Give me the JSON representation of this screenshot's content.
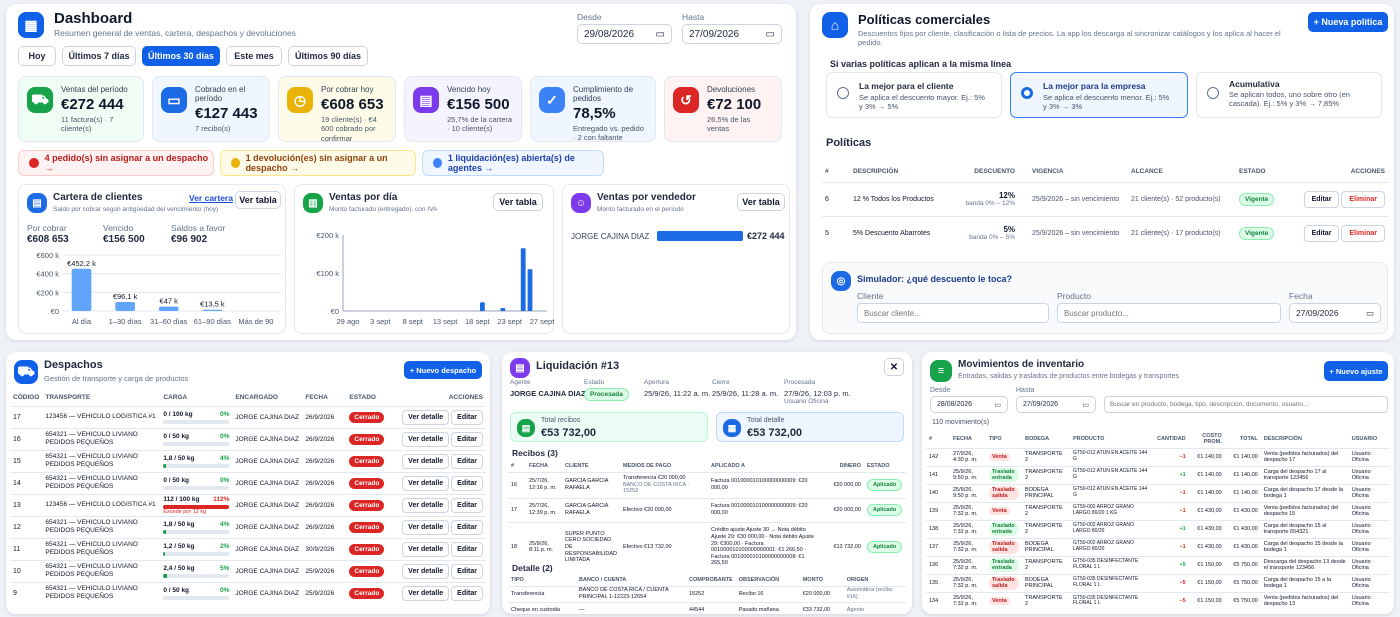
{
  "dashboard": {
    "title": "Dashboard",
    "subtitle": "Resumen general de ventas, cartera, despachos y devoluciones",
    "desde_label": "Desde",
    "desde_value": "29/08/2026",
    "hasta_label": "Hasta",
    "hasta_value": "27/09/2026",
    "ranges": [
      "Hoy",
      "Últimos 7 días",
      "Últimos 30 días",
      "Este mes",
      "Últimos 90 días"
    ],
    "kpis": [
      {
        "label": "Ventas del período",
        "value": "€272 444",
        "sub": "11 factura(s) · 7 cliente(s)"
      },
      {
        "label": "Cobrado en el período",
        "value": "€127 443",
        "sub": "7 recibo(s)"
      },
      {
        "label": "Por cobrar hoy",
        "value": "€608 653",
        "sub": "19 cliente(s) · €4 600 cobrado por confirmar"
      },
      {
        "label": "Vencido hoy",
        "value": "€156 500",
        "sub": "25,7% de la cartera · 10 cliente(s)"
      },
      {
        "label": "Cumplimiento de pedidos",
        "value": "78,5%",
        "sub": "Entregado vs. pedido · 2 con faltante"
      },
      {
        "label": "Devoluciones",
        "value": "€72 100",
        "sub": "26,5% de las ventas"
      }
    ],
    "alerts": [
      "4 pedido(s) sin asignar a un despacho →",
      "1 devolución(es) sin asignar a un despacho →",
      "1 liquidación(es) abierta(s) de agentes →"
    ],
    "cartera": {
      "title": "Cartera de clientes",
      "link": "Ver cartera",
      "button": "Ver tabla",
      "sub": "Saldo por cobrar según antigüedad del vencimiento (hoy)",
      "stats": [
        {
          "l": "Por cobrar",
          "v": "€608 653"
        },
        {
          "l": "Vencido",
          "v": "€156 500"
        },
        {
          "l": "Saldos a favor",
          "v": "€96 902"
        }
      ],
      "yticks": [
        "€600 k",
        "€400 k",
        "€200 k",
        "€0"
      ]
    },
    "ventas_dia": {
      "title": "Ventas por día",
      "sub": "Monto facturado (entregado), con IVA",
      "button": "Ver tabla",
      "yticks": [
        "€200 k",
        "€100 k",
        "€0"
      ]
    },
    "vendedor": {
      "title": "Ventas por vendedor",
      "sub": "Monto facturado en el período",
      "button": "Ver tabla",
      "name": "JORGE CAJINA DIAZ",
      "value": "€272 444"
    }
  },
  "chart_data": [
    {
      "type": "bar",
      "categories": [
        "Al día",
        "1–30 días",
        "31–60 días",
        "61–90 días",
        "Más de 90"
      ],
      "values": [
        452.2,
        96.1,
        47,
        13.5,
        0
      ],
      "labels": [
        "€452,2 k",
        "€96,1 k",
        "€47 k",
        "€13,5 k",
        ""
      ],
      "ylim": [
        0,
        600
      ]
    },
    {
      "type": "bar",
      "categories": [
        "29 ago",
        "3 sept",
        "8 sept",
        "13 sept",
        "18 sept",
        "23 sept",
        "27 sept"
      ],
      "values": [
        0,
        0,
        0,
        0,
        0,
        0,
        0,
        0,
        0,
        0,
        0,
        0,
        0,
        0,
        0,
        0,
        0,
        0,
        0,
        0,
        23,
        0,
        0,
        8,
        0,
        0,
        165,
        110,
        0,
        0
      ],
      "ylim": [
        0,
        200
      ]
    },
    {
      "type": "bar",
      "categories": [
        "JORGE CAJINA DIAZ"
      ],
      "values": [
        272444
      ]
    }
  ],
  "politicas": {
    "title": "Políticas comerciales",
    "sub": "Descuentos fijos por cliente, clasificación o lista de precios. La app los descarga al sincronizar catálogos y los aplica al hacer el pedido.",
    "new_button": "+ Nueva política",
    "question": "Si varias políticas aplican a la misma línea",
    "options": [
      {
        "t": "La mejor para el cliente",
        "d": "Se aplica el descuento mayor. Ej.: 5% y 3% → 5%"
      },
      {
        "t": "La mejor para la empresa",
        "d": "Se aplica el descuento menor. Ej.: 5% y 3% → 3%"
      },
      {
        "t": "Acumulativa",
        "d": "Se aplican todos, uno sobre otro (en cascada). Ej.: 5% y 3% → 7,85%"
      }
    ],
    "list_title": "Políticas",
    "headers": [
      "#",
      "DESCRIPCIÓN",
      "DESCUENTO",
      "VIGENCIA",
      "ALCANCE",
      "ESTADO",
      "ACCIONES"
    ],
    "rows": [
      {
        "n": "6",
        "desc": "12 % Todos los Productos",
        "pct": "12%",
        "band": "banda 0% – 12%",
        "vig": "25/9/2026 – sin vencimiento",
        "alc": "21 cliente(s) · 52 producto(s)",
        "estado": "Vigente"
      },
      {
        "n": "5",
        "desc": "5% Descuento Abarrotes",
        "pct": "5%",
        "band": "banda 0% – 5%",
        "vig": "25/9/2026 – sin vencimiento",
        "alc": "21 cliente(s) · 17 producto(s)",
        "estado": "Vigente"
      }
    ],
    "edit": "Editar",
    "delete": "Eliminar",
    "sim": {
      "title": "Simulador: ¿qué descuento le toca?",
      "cliente_label": "Cliente",
      "cliente_ph": "Buscar cliente...",
      "producto_label": "Producto",
      "producto_ph": "Buscar producto...",
      "fecha_label": "Fecha",
      "fecha_value": "27/09/2026"
    }
  },
  "despachos": {
    "title": "Despachos",
    "sub": "Gestión de transporte y carga de productos",
    "new_button": "+ Nuevo despacho",
    "headers": [
      "CÓDIGO",
      "TRANSPORTE",
      "CARGA",
      "ENCARGADO",
      "FECHA",
      "ESTADO",
      "ACCIONES"
    ],
    "rows": [
      {
        "c": "17",
        "t": "123456 — VEHICULO LOGISTICA #1",
        "carga": "0 / 100 kg",
        "pct": "0%",
        "pv": 0,
        "enc": "JORGE CAJINA DIAZ",
        "f": "26/9/2026",
        "e": "Cerrado"
      },
      {
        "c": "16",
        "t": "654321 — VEHICULO LIVIANO PEDIDOS PEQUEÑOS",
        "carga": "0 / 50 kg",
        "pct": "0%",
        "pv": 0,
        "enc": "JORGE CAJINA DIAZ",
        "f": "26/9/2026",
        "e": "Cerrado"
      },
      {
        "c": "15",
        "t": "654321 — VEHICULO LIVIANO PEDIDOS PEQUEÑOS",
        "carga": "1,8 / 50 kg",
        "pct": "4%",
        "pv": 4,
        "enc": "JORGE CAJINA DIAZ",
        "f": "26/9/2026",
        "e": "Cerrado"
      },
      {
        "c": "14",
        "t": "654321 — VEHICULO LIVIANO PEDIDOS PEQUEÑOS",
        "carga": "0 / 50 kg",
        "pct": "0%",
        "pv": 0,
        "enc": "JORGE CAJINA DIAZ",
        "f": "26/9/2026",
        "e": "Cerrado"
      },
      {
        "c": "13",
        "t": "123456 — VEHICULO LOGISTICA #1",
        "carga": "112 / 100 kg",
        "pct": "112%",
        "pv": 112,
        "over": "Excede por 12 kg",
        "enc": "JORGE CAJINA DIAZ",
        "f": "26/9/2026",
        "e": "Cerrado"
      },
      {
        "c": "12",
        "t": "654321 — VEHICULO LIVIANO PEDIDOS PEQUEÑOS",
        "carga": "1,8 / 50 kg",
        "pct": "4%",
        "pv": 4,
        "enc": "JORGE CAJINA DIAZ",
        "f": "26/9/2026",
        "e": "Cerrado"
      },
      {
        "c": "11",
        "t": "654321 — VEHICULO LIVIANO PEDIDOS PEQUEÑOS",
        "carga": "1,2 / 50 kg",
        "pct": "2%",
        "pv": 2,
        "enc": "JORGE CAJINA DIAZ",
        "f": "30/9/2026",
        "e": "Cerrado"
      },
      {
        "c": "10",
        "t": "654321 — VEHICULO LIVIANO PEDIDOS PEQUEÑOS",
        "carga": "2,4 / 50 kg",
        "pct": "5%",
        "pv": 5,
        "enc": "JORGE CAJINA DIAZ",
        "f": "25/9/2026",
        "e": "Cerrado"
      },
      {
        "c": "9",
        "t": "654321 — VEHICULO LIVIANO PEDIDOS PEQUEÑOS",
        "carga": "0 / 50 kg",
        "pct": "0%",
        "pv": 0,
        "enc": "JORGE CAJINA DIAZ",
        "f": "25/9/2026",
        "e": "Cerrado"
      }
    ],
    "detail": "Ver detalle",
    "edit": "Editar"
  },
  "liquidacion": {
    "title": "Liquidación #13",
    "meta": [
      {
        "l": "Agente",
        "v": "JORGE CAJINA DIAZ"
      },
      {
        "l": "Estado",
        "v": "Procesada"
      },
      {
        "l": "Apertura",
        "v": "25/9/26, 11:22 a. m."
      },
      {
        "l": "Cierre",
        "v": "25/9/26, 11:28 a. m."
      },
      {
        "l": "Procesada",
        "v": "27/9/26, 12:03 p. m.",
        "s": "Usuario Oficina"
      }
    ],
    "tot_recibos_l": "Total recibos",
    "tot_recibos": "€53 732,00",
    "tot_detalle_l": "Total detalle",
    "tot_detalle": "€53 732,00",
    "recibos_title": "Recibos (3)",
    "rh": [
      "#",
      "FECHA",
      "CLIENTE",
      "MEDIOS DE PAGO",
      "APLICADO A",
      "DINERO",
      "ESTADO"
    ],
    "recibos": [
      {
        "n": "16",
        "f": "25/7/26, 12:16 p. m.",
        "c": "GARCIA GARCIA RAFAELA",
        "m": "Transferencia €20 000,00",
        "m2": "BANCO DE COSTA RICA · 15252",
        "a": "Factura 001000010100000000009: €20 000,00",
        "d": "€20 000,00",
        "e": "Aplicado"
      },
      {
        "n": "17",
        "f": "25/7/26, 12:39 p. m.",
        "c": "GARCIA GARCIA RAFAELA",
        "m": "Efectivo €20 000,00",
        "m2": "",
        "a": "Factura 001000010100000000009: €20 000,00",
        "d": "€20 000,00",
        "e": "Aplicado"
      },
      {
        "n": "18",
        "f": "25/9/26, 8:11 p. m.",
        "c": "SUPER PUNTO CERO SOCIEDAD DE RESPONSABILIDAD LIMITADA",
        "m": "Efectivo €13 732,00",
        "m2": "",
        "a": "Crédito ajuste Ajuste 30 → Nota débito Ajuste 29: €30 000,00 · Nota débito Ajuste 29: €300,00 · Factura 001000010100000000001: €1 266,50 · Factura 001000010100000000008: €1 265,50",
        "d": "€13 732,00",
        "e": "Aplicado"
      }
    ],
    "detalle_title": "Detalle (2)",
    "dh": [
      "TIPO",
      "BANCO / CUENTA",
      "COMPROBANTE",
      "OBSERVACIÓN",
      "MONTO",
      "ORIGEN"
    ],
    "detalle": [
      {
        "t": "Transferencia",
        "b": "BANCO DE COSTA RICA / CUENTA PRINCIPAL 1-12223-12654",
        "c": "15252",
        "o": "Recibo 16",
        "m": "€20 000,00",
        "or": "Automática (recibo #16)"
      },
      {
        "t": "Cheque en custodia",
        "b": "—",
        "c": "44544",
        "o": "Pasado mañana",
        "m": "€33 732,00",
        "or": "Agente"
      }
    ]
  },
  "inventario": {
    "title": "Movimientos de inventario",
    "sub": "Entradas, salidas y traslados de productos entre bodegas y transportes",
    "new_button": "+ Nuevo ajuste",
    "desde_label": "Desde",
    "desde_value": "28/08/2026",
    "hasta_label": "Hasta",
    "hasta_value": "27/09/2026",
    "search_ph": "Buscar en producto, bodega, tipo, descripción, documento, usuario...",
    "count": "110 movimiento(s)",
    "headers": [
      "#",
      "FECHA",
      "TIPO",
      "BODEGA",
      "PRODUCTO",
      "CANTIDAD",
      "COSTO PROM.",
      "TOTAL",
      "DESCRIPCIÓN",
      "USUARIO"
    ],
    "rows": [
      {
        "n": "142",
        "f": "27/9/26, 4:30 p. m.",
        "t": "Venta",
        "b": "TRANSPORTE 2",
        "p": "GT50-012 ATUN EN ACEITE 144 G",
        "q": "−1",
        "c": "€1 140,00",
        "tot": "€1 140,00",
        "d": "Venta (pedidos facturados) del despacho 17",
        "u": "Usuario Oficina"
      },
      {
        "n": "141",
        "f": "25/9/26, 9:50 p. m.",
        "t": "Traslado entrada",
        "b": "TRANSPORTE 2",
        "p": "GT50-012 ATUN EN ACEITE 144 G",
        "q": "+1",
        "c": "€1 140,00",
        "tot": "€1 140,00",
        "d": "Carga del despacho 17 al transporte 123456",
        "u": "Usuario Oficina"
      },
      {
        "n": "140",
        "f": "25/9/26, 9:50 p. m.",
        "t": "Traslado salida",
        "b": "BODEGA PRINCIPAL",
        "p": "GT50-012 ATUN EN ACEITE 144 G",
        "q": "−1",
        "c": "€1 140,00",
        "tot": "€1 140,00",
        "d": "Carga del despacho 17 desde la bodega 1",
        "u": "Usuario Oficina"
      },
      {
        "n": "139",
        "f": "25/9/26, 7:32 p. m.",
        "t": "Venta",
        "b": "TRANSPORTE 2",
        "p": "GT50-002 ARROZ GRANO LARGO 80/20 1 KG",
        "q": "−1",
        "c": "€1 430,00",
        "tot": "€1 430,00",
        "d": "Venta (pedidos facturados) del despacho 15",
        "u": "Usuario Oficina"
      },
      {
        "n": "138",
        "f": "25/9/26, 7:32 p. m.",
        "t": "Traslado entrada",
        "b": "TRANSPORTE 2",
        "p": "GT50-002 ARROZ GRANO LARGO 80/20",
        "q": "+1",
        "c": "€1 430,00",
        "tot": "€1 430,00",
        "d": "Carga del despacho 15 al transporte 654321",
        "u": "Usuario Oficina"
      },
      {
        "n": "137",
        "f": "25/9/26, 7:32 p. m.",
        "t": "Traslado salida",
        "b": "BODEGA PRINCIPAL",
        "p": "GT50-002 ARROZ GRANO LARGO 80/20",
        "q": "−1",
        "c": "€1 430,00",
        "tot": "€1 430,00",
        "d": "Carga del despacho 15 desde la bodega 1",
        "u": "Usuario Oficina"
      },
      {
        "n": "136",
        "f": "25/9/26, 7:32 p. m.",
        "t": "Traslado entrada",
        "b": "TRANSPORTE 2",
        "p": "GT50-035 DESINFECTANTE FLORAL 1 L",
        "q": "+5",
        "c": "€1 150,00",
        "tot": "€5 750,00",
        "d": "Descarga del despacho 13 desde el transporte 123456",
        "u": "Usuario Oficina"
      },
      {
        "n": "135",
        "f": "25/9/26, 7:32 p. m.",
        "t": "Traslado salida",
        "b": "BODEGA PRINCIPAL",
        "p": "GT50-035 DESINFECTANTE FLORAL 1 L",
        "q": "−5",
        "c": "€1 150,00",
        "tot": "€5 750,00",
        "d": "Carga del despacho 15 a la bodega 1",
        "u": "Usuario Oficina"
      },
      {
        "n": "134",
        "f": "25/9/26, 7:32 p. m.",
        "t": "Venta",
        "b": "TRANSPORTE 2",
        "p": "GT50-035 DESINFECTANTE FLORAL 1 L",
        "q": "−5",
        "c": "€1 150,00",
        "tot": "€5 750,00",
        "d": "Venta (pedidos facturados) del despacho 13",
        "u": "Usuario Oficina"
      }
    ]
  }
}
